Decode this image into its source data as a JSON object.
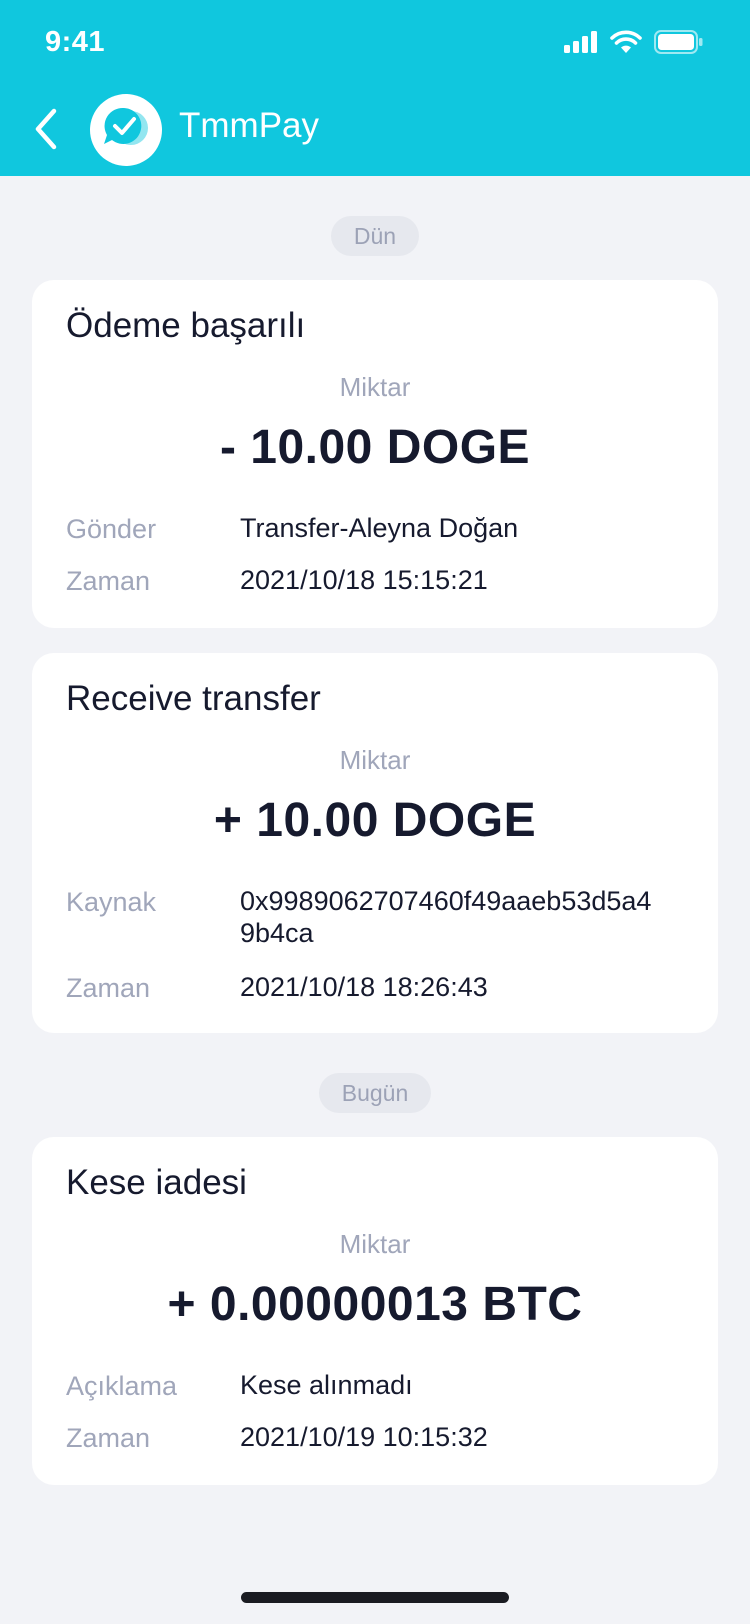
{
  "status_bar": {
    "time": "9:41"
  },
  "header": {
    "title": "TmmPay"
  },
  "sections": [
    {
      "date": "Dün",
      "cards": [
        {
          "title": "Ödeme başarılı",
          "amount_label": "Miktar",
          "amount": "- 10.00 DOGE",
          "rows": [
            {
              "label": "Gönder",
              "value": "Transfer-Aleyna Doğan"
            },
            {
              "label": "Zaman",
              "value": "2021/10/18 15:15:21"
            }
          ]
        },
        {
          "title": "Receive transfer",
          "amount_label": "Miktar",
          "amount": "+ 10.00 DOGE",
          "rows": [
            {
              "label": "Kaynak",
              "value": "0x9989062707460f49aaeb53d5a49b4ca"
            },
            {
              "label": "Zaman",
              "value": "2021/10/18 18:26:43"
            }
          ]
        }
      ]
    },
    {
      "date": "Bugün",
      "cards": [
        {
          "title": "Kese iadesi",
          "amount_label": "Miktar",
          "amount": "+ 0.00000013 BTC",
          "rows": [
            {
              "label": "Açıklama",
              "value": "Kese alınmadı"
            },
            {
              "label": "Zaman",
              "value": "2021/10/19 10:15:32"
            }
          ]
        }
      ]
    }
  ],
  "icons": {
    "back": "chevron-left-icon",
    "avatar": "chat-check-icon",
    "signal": "cellular-signal-icon",
    "wifi": "wifi-icon",
    "battery": "battery-icon"
  },
  "colors": {
    "header": "#10C7DE",
    "background": "#F2F3F7",
    "text": "#161A2E",
    "muted": "#A0A6BA"
  }
}
